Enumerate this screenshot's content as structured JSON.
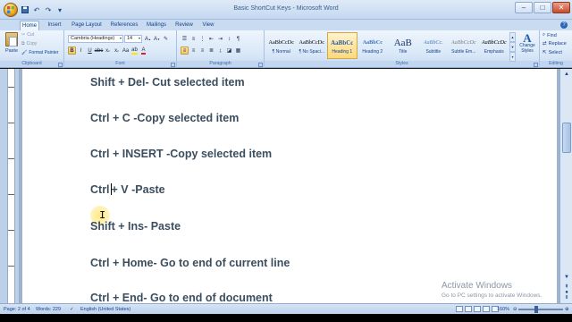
{
  "window": {
    "title": "Basic ShortCut Keys - Microsoft Word"
  },
  "tabs": [
    {
      "label": "Home",
      "active": true
    },
    {
      "label": "Insert"
    },
    {
      "label": "Page Layout"
    },
    {
      "label": "References"
    },
    {
      "label": "Mailings"
    },
    {
      "label": "Review"
    },
    {
      "label": "View"
    }
  ],
  "ribbon": {
    "clipboard": {
      "label": "Clipboard",
      "paste": "Paste",
      "cut": "Cut",
      "copy": "Copy",
      "format_painter": "Format Painter"
    },
    "font": {
      "label": "Font",
      "font_name": "Cambria (Headings)",
      "font_size": "14"
    },
    "paragraph": {
      "label": "Paragraph"
    },
    "styles": {
      "label": "Styles",
      "items": [
        {
          "sample": "AaBbCcDc",
          "name": "¶ Normal"
        },
        {
          "sample": "AaBbCcDc",
          "name": "¶ No Spaci..."
        },
        {
          "sample": "AaBbCc",
          "name": "Heading 1",
          "active": true
        },
        {
          "sample": "AaBbCc",
          "name": "Heading 2"
        },
        {
          "sample": "AaB",
          "name": "Title"
        },
        {
          "sample": "AaBbCc.",
          "name": "Subtitle"
        },
        {
          "sample": "AaBbCcDc",
          "name": "Subtle Em..."
        },
        {
          "sample": "AaBbCcDc",
          "name": "Emphasis"
        }
      ],
      "change_styles": "Change Styles"
    },
    "editing": {
      "label": "Editing",
      "find": "Find",
      "replace": "Replace",
      "select": "Select"
    }
  },
  "document": {
    "lines": [
      "Shift + Del- Cut selected item",
      "Ctrl + C -Copy selected item",
      "Ctrl + INSERT -Copy selected item",
      "Ctrl",
      "+ V -Paste",
      "Shift + Ins- Paste",
      "Ctrl + Home- Go to end of current line",
      "Ctrl + End- Go to end of document"
    ]
  },
  "watermark": {
    "line1": "Activate Windows",
    "line2": "Go to PC settings to activate Windows."
  },
  "statusbar": {
    "page": "Page: 2 of 4",
    "words": "Words: 229",
    "language": "English (United States)",
    "zoom": "160%"
  }
}
